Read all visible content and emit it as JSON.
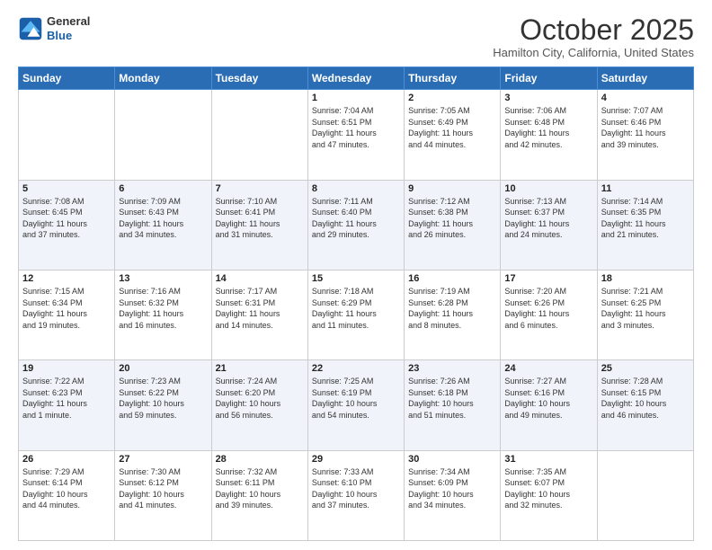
{
  "header": {
    "logo_line1": "General",
    "logo_line2": "Blue",
    "title": "October 2025",
    "subtitle": "Hamilton City, California, United States"
  },
  "days_of_week": [
    "Sunday",
    "Monday",
    "Tuesday",
    "Wednesday",
    "Thursday",
    "Friday",
    "Saturday"
  ],
  "weeks": [
    {
      "shade": "white",
      "days": [
        {
          "num": "",
          "info": ""
        },
        {
          "num": "",
          "info": ""
        },
        {
          "num": "",
          "info": ""
        },
        {
          "num": "1",
          "info": "Sunrise: 7:04 AM\nSunset: 6:51 PM\nDaylight: 11 hours\nand 47 minutes."
        },
        {
          "num": "2",
          "info": "Sunrise: 7:05 AM\nSunset: 6:49 PM\nDaylight: 11 hours\nand 44 minutes."
        },
        {
          "num": "3",
          "info": "Sunrise: 7:06 AM\nSunset: 6:48 PM\nDaylight: 11 hours\nand 42 minutes."
        },
        {
          "num": "4",
          "info": "Sunrise: 7:07 AM\nSunset: 6:46 PM\nDaylight: 11 hours\nand 39 minutes."
        }
      ]
    },
    {
      "shade": "shaded",
      "days": [
        {
          "num": "5",
          "info": "Sunrise: 7:08 AM\nSunset: 6:45 PM\nDaylight: 11 hours\nand 37 minutes."
        },
        {
          "num": "6",
          "info": "Sunrise: 7:09 AM\nSunset: 6:43 PM\nDaylight: 11 hours\nand 34 minutes."
        },
        {
          "num": "7",
          "info": "Sunrise: 7:10 AM\nSunset: 6:41 PM\nDaylight: 11 hours\nand 31 minutes."
        },
        {
          "num": "8",
          "info": "Sunrise: 7:11 AM\nSunset: 6:40 PM\nDaylight: 11 hours\nand 29 minutes."
        },
        {
          "num": "9",
          "info": "Sunrise: 7:12 AM\nSunset: 6:38 PM\nDaylight: 11 hours\nand 26 minutes."
        },
        {
          "num": "10",
          "info": "Sunrise: 7:13 AM\nSunset: 6:37 PM\nDaylight: 11 hours\nand 24 minutes."
        },
        {
          "num": "11",
          "info": "Sunrise: 7:14 AM\nSunset: 6:35 PM\nDaylight: 11 hours\nand 21 minutes."
        }
      ]
    },
    {
      "shade": "white",
      "days": [
        {
          "num": "12",
          "info": "Sunrise: 7:15 AM\nSunset: 6:34 PM\nDaylight: 11 hours\nand 19 minutes."
        },
        {
          "num": "13",
          "info": "Sunrise: 7:16 AM\nSunset: 6:32 PM\nDaylight: 11 hours\nand 16 minutes."
        },
        {
          "num": "14",
          "info": "Sunrise: 7:17 AM\nSunset: 6:31 PM\nDaylight: 11 hours\nand 14 minutes."
        },
        {
          "num": "15",
          "info": "Sunrise: 7:18 AM\nSunset: 6:29 PM\nDaylight: 11 hours\nand 11 minutes."
        },
        {
          "num": "16",
          "info": "Sunrise: 7:19 AM\nSunset: 6:28 PM\nDaylight: 11 hours\nand 8 minutes."
        },
        {
          "num": "17",
          "info": "Sunrise: 7:20 AM\nSunset: 6:26 PM\nDaylight: 11 hours\nand 6 minutes."
        },
        {
          "num": "18",
          "info": "Sunrise: 7:21 AM\nSunset: 6:25 PM\nDaylight: 11 hours\nand 3 minutes."
        }
      ]
    },
    {
      "shade": "shaded",
      "days": [
        {
          "num": "19",
          "info": "Sunrise: 7:22 AM\nSunset: 6:23 PM\nDaylight: 11 hours\nand 1 minute."
        },
        {
          "num": "20",
          "info": "Sunrise: 7:23 AM\nSunset: 6:22 PM\nDaylight: 10 hours\nand 59 minutes."
        },
        {
          "num": "21",
          "info": "Sunrise: 7:24 AM\nSunset: 6:20 PM\nDaylight: 10 hours\nand 56 minutes."
        },
        {
          "num": "22",
          "info": "Sunrise: 7:25 AM\nSunset: 6:19 PM\nDaylight: 10 hours\nand 54 minutes."
        },
        {
          "num": "23",
          "info": "Sunrise: 7:26 AM\nSunset: 6:18 PM\nDaylight: 10 hours\nand 51 minutes."
        },
        {
          "num": "24",
          "info": "Sunrise: 7:27 AM\nSunset: 6:16 PM\nDaylight: 10 hours\nand 49 minutes."
        },
        {
          "num": "25",
          "info": "Sunrise: 7:28 AM\nSunset: 6:15 PM\nDaylight: 10 hours\nand 46 minutes."
        }
      ]
    },
    {
      "shade": "white",
      "days": [
        {
          "num": "26",
          "info": "Sunrise: 7:29 AM\nSunset: 6:14 PM\nDaylight: 10 hours\nand 44 minutes."
        },
        {
          "num": "27",
          "info": "Sunrise: 7:30 AM\nSunset: 6:12 PM\nDaylight: 10 hours\nand 41 minutes."
        },
        {
          "num": "28",
          "info": "Sunrise: 7:32 AM\nSunset: 6:11 PM\nDaylight: 10 hours\nand 39 minutes."
        },
        {
          "num": "29",
          "info": "Sunrise: 7:33 AM\nSunset: 6:10 PM\nDaylight: 10 hours\nand 37 minutes."
        },
        {
          "num": "30",
          "info": "Sunrise: 7:34 AM\nSunset: 6:09 PM\nDaylight: 10 hours\nand 34 minutes."
        },
        {
          "num": "31",
          "info": "Sunrise: 7:35 AM\nSunset: 6:07 PM\nDaylight: 10 hours\nand 32 minutes."
        },
        {
          "num": "",
          "info": ""
        }
      ]
    }
  ]
}
